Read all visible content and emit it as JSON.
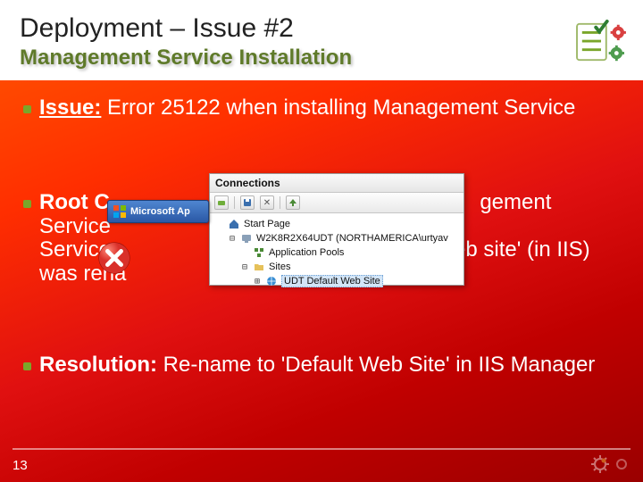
{
  "header": {
    "title": "Deployment – Issue #2",
    "subtitle": "Management Service Installation"
  },
  "bullets": {
    "issue_label": "Issue:",
    "issue_text": " Error 25122 when installing Management Service",
    "root_label": "Root C",
    "root_text_a": "gement Service",
    "root_text_b": "eb site' (in IIS) was rena",
    "res_label": "Resolution:",
    "res_text": " Re-name to 'Default Web Site' in IIS Manager"
  },
  "iis": {
    "connections": "Connections",
    "start_page": "Start Page",
    "server": "W2K8R2X64UDT (NORTHAMERICA\\urtyav",
    "app_pools": "Application Pools",
    "sites": "Sites",
    "site": "UDT Default Web Site"
  },
  "taskbar": {
    "label": "Microsoft Ap"
  },
  "footer": {
    "page": "13"
  }
}
